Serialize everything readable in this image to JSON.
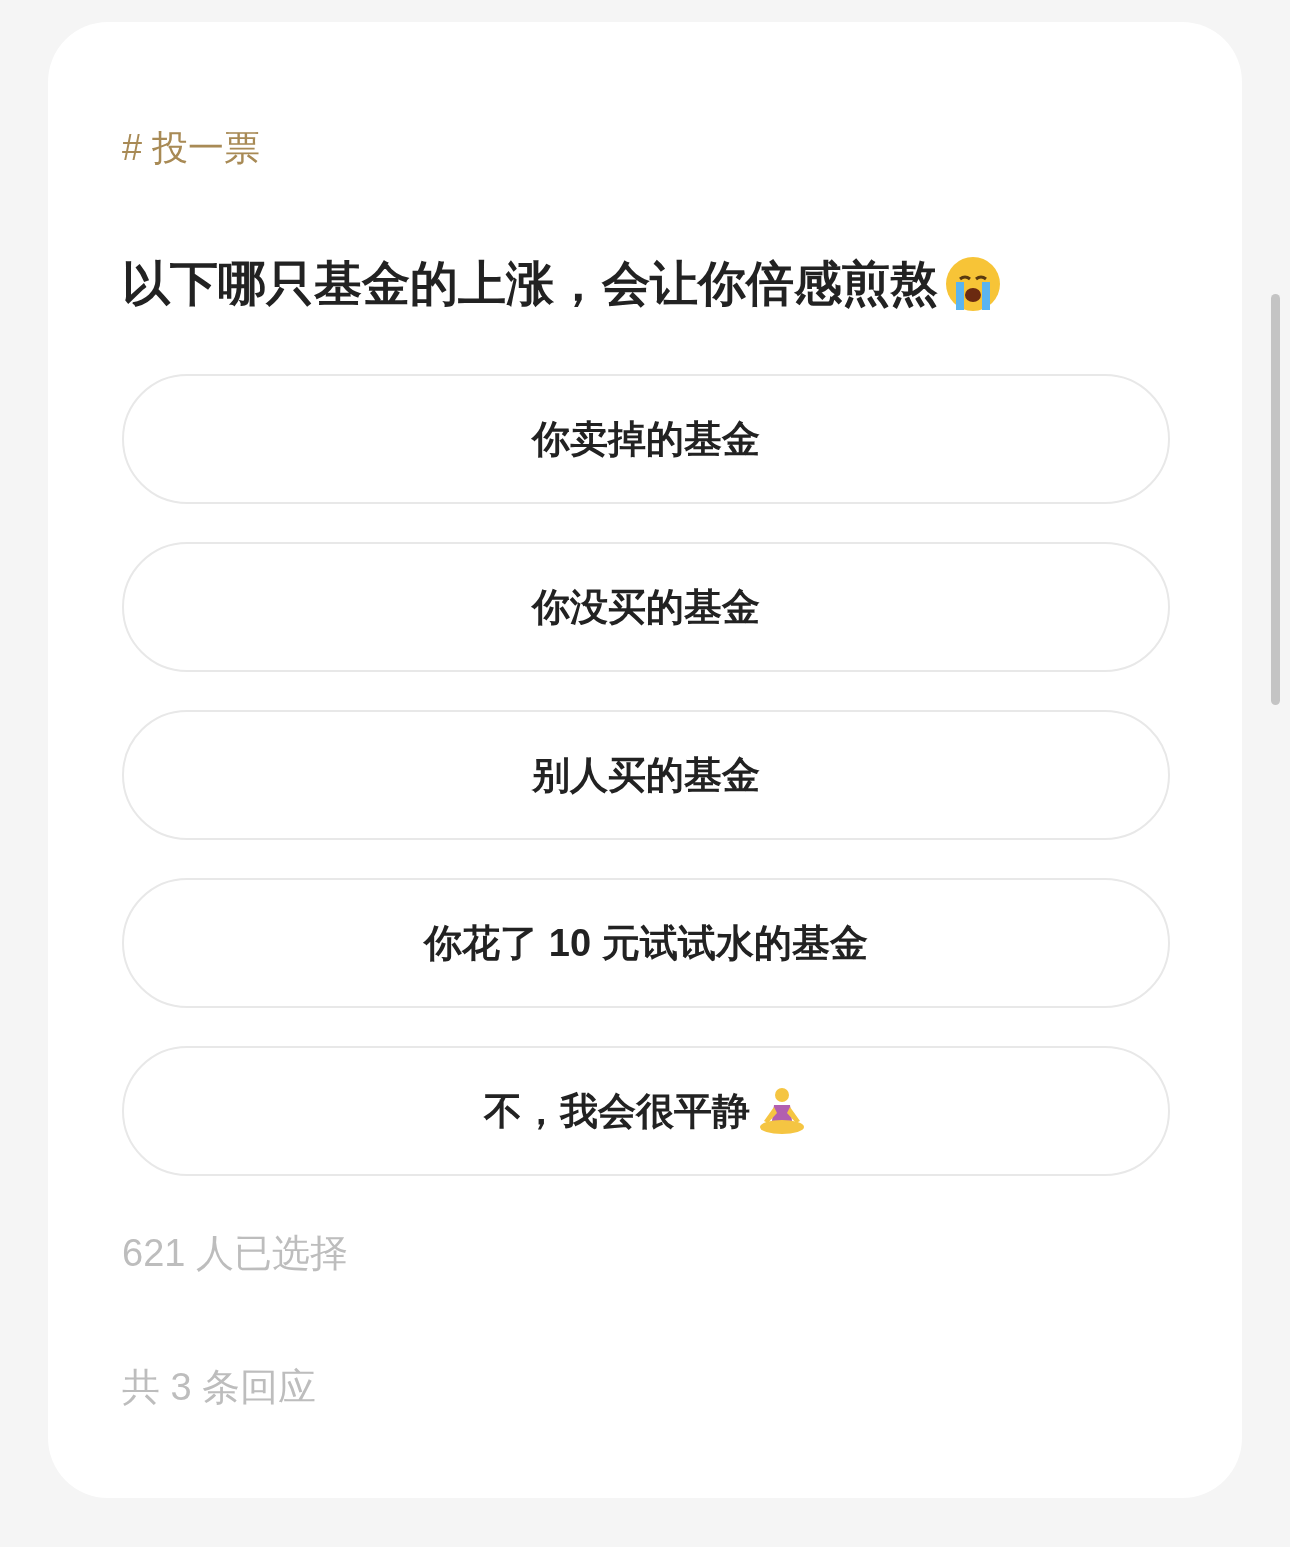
{
  "tag": "# 投一票",
  "question": {
    "text": "以下哪只基金的上涨，会让你倍感煎熬",
    "kind": "crying"
  },
  "options": [
    {
      "label": "你卖掉的基金",
      "kind": "plain"
    },
    {
      "label": "你没买的基金",
      "kind": "plain"
    },
    {
      "label": "别人买的基金",
      "kind": "plain"
    },
    {
      "label": "你花了 10 元试试水的基金",
      "kind": "plain"
    },
    {
      "label": "不，我会很平静",
      "kind": "meditating"
    }
  ],
  "voters": "621 人已选择",
  "replies": "共 3 条回应"
}
